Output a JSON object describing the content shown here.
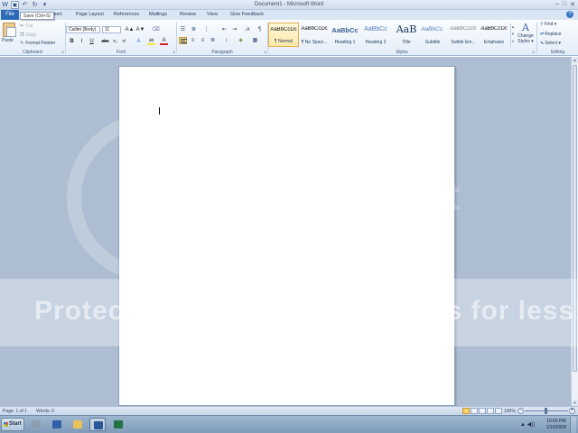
{
  "window": {
    "title": "Document1 - Microsoft Word",
    "minimize": "–",
    "maximize": "□",
    "close": "✕"
  },
  "quick_access": {
    "save_icon": "save-icon",
    "undo_icon": "undo-icon",
    "redo_icon": "redo-icon",
    "customize_icon": "chevron-down-icon"
  },
  "tooltip": "Save (Ctrl+S)",
  "tabs": {
    "file": "File",
    "items": [
      "Insert",
      "Page Layout",
      "References",
      "Mailings",
      "Review",
      "View",
      "Give Feedback"
    ]
  },
  "ribbon": {
    "clipboard": {
      "label": "Clipboard",
      "paste": "Paste",
      "cut": "Cut",
      "copy": "Copy",
      "format_painter": "Format Painter"
    },
    "font": {
      "label": "Font",
      "family": "Calibri (Body)",
      "size": "11",
      "grow": "A▲",
      "shrink": "A▼",
      "bold": "B",
      "italic": "I",
      "underline": "U",
      "strikethrough": "abc",
      "subscript": "x₂",
      "superscript": "x²",
      "effects": "A",
      "highlight": "ab",
      "font_color": "A",
      "highlight_color": "#f4e639",
      "font_color_value": "#d8222a"
    },
    "paragraph": {
      "label": "Paragraph",
      "sort": "↓A",
      "pilcrow": "¶"
    },
    "styles": {
      "label": "Styles",
      "items": [
        {
          "preview": "AaBbCcDc",
          "name": "¶ Normal",
          "selected": true
        },
        {
          "preview": "AaBbCcDc",
          "name": "¶ No Spaci..."
        },
        {
          "preview": "AaBbCc",
          "name": "Heading 1"
        },
        {
          "preview": "AaBbCc",
          "name": "Heading 2"
        },
        {
          "preview": "AaB",
          "name": "Title"
        },
        {
          "preview": "AaBbCc.",
          "name": "Subtitle"
        },
        {
          "preview": "AaBbCcDc",
          "name": "Subtle Em..."
        },
        {
          "preview": "AaBbCcDc",
          "name": "Emphasis"
        }
      ],
      "change_styles_line1": "Change",
      "change_styles_line2": "Styles ▾"
    },
    "editing": {
      "label": "Editing",
      "find": "Find ▾",
      "replace": "Replace",
      "select": "Select ▾"
    }
  },
  "status": {
    "page": "Page: 1 of 1",
    "words": "Words: 0",
    "zoom": "100%",
    "zoom_minus": "−",
    "zoom_plus": "+",
    "zoom_level": 1.0
  },
  "watermark": {
    "text": "Protect more of your memories for less!",
    "word": "et"
  },
  "taskbar": {
    "start": "Start",
    "clock_time": "10:50 PM",
    "clock_date": "1/10/2009",
    "tray": "▲ ◀))"
  }
}
